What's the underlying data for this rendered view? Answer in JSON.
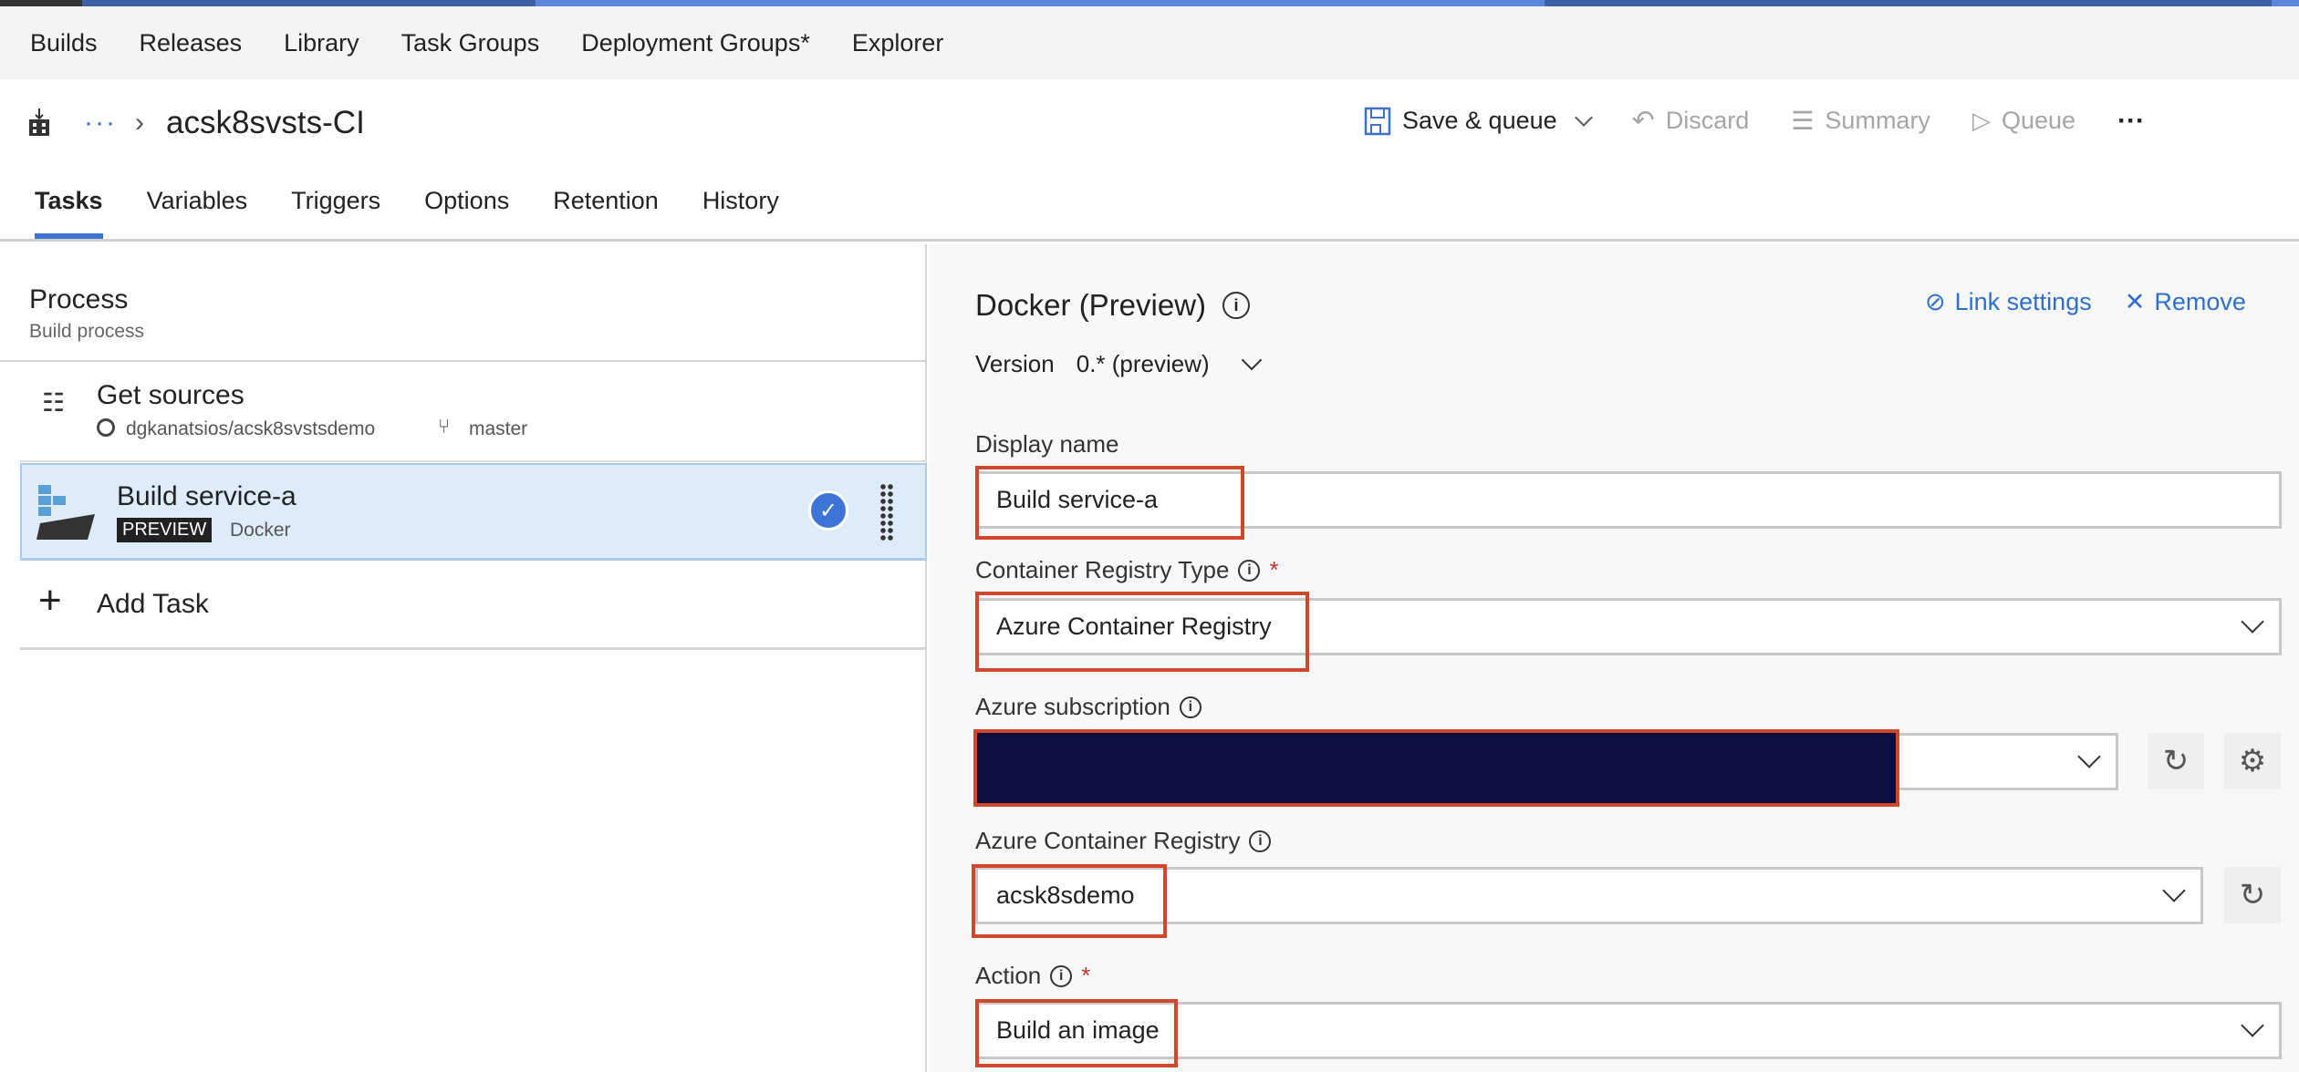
{
  "top_nav": {
    "items": [
      "Builds",
      "Releases",
      "Library",
      "Task Groups",
      "Deployment Groups*",
      "Explorer"
    ]
  },
  "header": {
    "breadcrumb_more": "···",
    "title": "acsk8svsts-CI"
  },
  "toolbar": {
    "save_queue": "Save & queue",
    "discard": "Discard",
    "summary": "Summary",
    "queue": "Queue",
    "more": "···"
  },
  "tabs": [
    "Tasks",
    "Variables",
    "Triggers",
    "Options",
    "Retention",
    "History"
  ],
  "process": {
    "title": "Process",
    "subtitle": "Build process"
  },
  "tasks": {
    "get_sources": {
      "title": "Get sources",
      "repo": "dgkanatsios/acsk8svstsdemo",
      "branch": "master"
    },
    "build": {
      "title": "Build service-a",
      "badge": "PREVIEW",
      "type": "Docker"
    },
    "add_task": "Add Task"
  },
  "detail": {
    "title": "Docker (Preview)",
    "link_settings": "Link settings",
    "remove": "Remove",
    "version_label": "Version",
    "version_value": "0.* (preview)",
    "display_name": {
      "label": "Display name",
      "value": "Build service-a"
    },
    "registry_type": {
      "label": "Container Registry Type",
      "value": "Azure Container Registry"
    },
    "subscription": {
      "label": "Azure subscription",
      "value": ""
    },
    "acr": {
      "label": "Azure Container Registry",
      "value": "acsk8sdemo"
    },
    "action": {
      "label": "Action",
      "value": "Build an image"
    }
  },
  "colors": {
    "accent": "#2d6fd1",
    "highlight_box": "#d2472a",
    "selected_row": "#deecf9",
    "redaction": "#0b0f3f"
  }
}
